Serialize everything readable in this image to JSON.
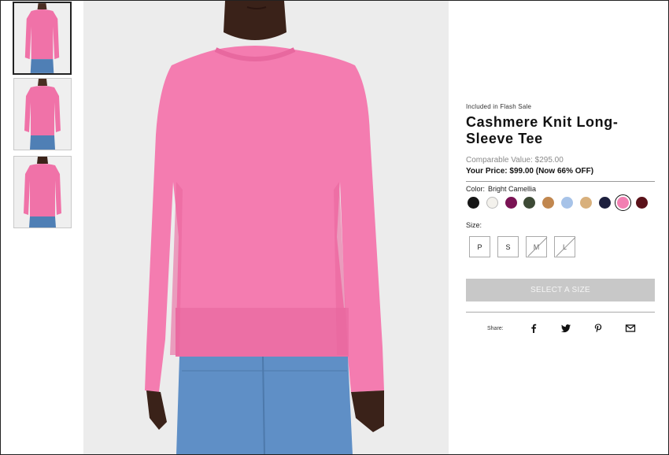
{
  "gallery": {
    "thumbnails": [
      {
        "icon": "product-front-photo",
        "active": true
      },
      {
        "icon": "product-front-photo-alt",
        "active": false
      },
      {
        "icon": "product-back-photo",
        "active": false
      }
    ],
    "main_image": "model-wearing-pink-sweater-photo"
  },
  "product": {
    "badge": "Included in Flash Sale",
    "title": "Cashmere Knit Long-Sleeve Tee",
    "comparable_value": "Comparable Value: $295.00",
    "your_price": "Your Price: $99.00 (Now 66% OFF)"
  },
  "color": {
    "label": "Color:",
    "selected_name": "Bright Camellia",
    "swatches": [
      {
        "color": "#161616"
      },
      {
        "color": "#f3f1ec"
      },
      {
        "color": "#7a1354"
      },
      {
        "color": "#3d4a35"
      },
      {
        "color": "#c1874f"
      },
      {
        "color": "#a7c3e8"
      },
      {
        "color": "#d8b07c"
      },
      {
        "color": "#1c1f3d"
      },
      {
        "color": "#f27fb2",
        "selected": true
      },
      {
        "color": "#5a1119"
      }
    ]
  },
  "size": {
    "label": "Size:",
    "options": [
      {
        "label": "P",
        "available": true
      },
      {
        "label": "S",
        "available": true
      },
      {
        "label": "M",
        "available": false
      },
      {
        "label": "L",
        "available": false
      }
    ]
  },
  "cta": {
    "label": "SELECT A SIZE"
  },
  "share": {
    "label": "Share:",
    "icons": [
      "facebook-icon",
      "twitter-icon",
      "pinterest-icon",
      "email-icon"
    ]
  }
}
